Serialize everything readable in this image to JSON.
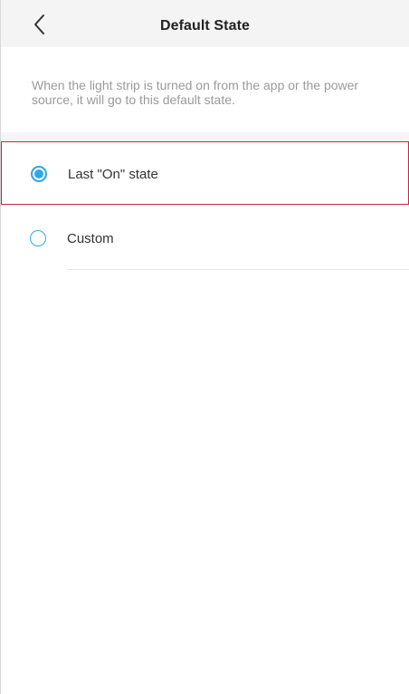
{
  "header": {
    "title": "Default State",
    "back_icon": "chevron-left-icon"
  },
  "description": "When the light strip is turned on from the app or the power source, it will go to this default state.",
  "options": [
    {
      "label": "Last \"On\" state",
      "selected": true
    },
    {
      "label": "Custom",
      "selected": false
    }
  ],
  "colors": {
    "accent": "#2ea8e8",
    "highlight_border": "#c8263d",
    "header_bg": "#f4f4f4",
    "description_text": "#9a9a9a"
  }
}
